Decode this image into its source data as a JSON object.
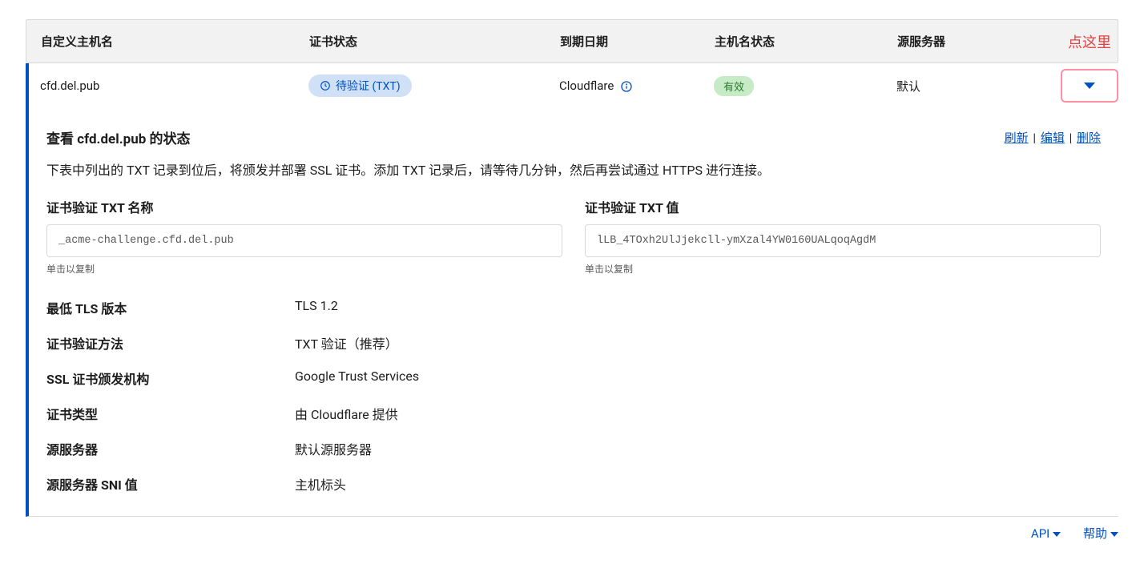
{
  "header": {
    "hostname": "自定义主机名",
    "cert_status": "证书状态",
    "expiry": "到期日期",
    "host_status": "主机名状态",
    "origin": "源服务器",
    "hint": "点这里"
  },
  "row": {
    "hostname": "cfd.del.pub",
    "cert_status_badge": "待验证 (TXT)",
    "expiry": "Cloudflare",
    "host_status_badge": "有效",
    "origin": "默认"
  },
  "detail": {
    "title": "查看 cfd.del.pub 的状态",
    "actions": {
      "refresh": "刷新",
      "edit": "编辑",
      "delete": "删除"
    },
    "desc": "下表中列出的 TXT 记录到位后，将颁发并部署 SSL 证书。添加 TXT 记录后，请等待几分钟，然后再尝试通过 HTTPS 进行连接。",
    "txt_name_label": "证书验证 TXT 名称",
    "txt_name_value": "_acme-challenge.cfd.del.pub",
    "txt_value_label": "证书验证 TXT 值",
    "txt_value_value": "lLB_4TOxh2UlJjekcll-ymXzal4YW0160UALqoqAgdM",
    "copy_hint": "单击以复制",
    "props": {
      "min_tls_label": "最低 TLS 版本",
      "min_tls_value": "TLS 1.2",
      "cert_method_label": "证书验证方法",
      "cert_method_value": "TXT 验证（推荐）",
      "ssl_ca_label": "SSL 证书颁发机构",
      "ssl_ca_value": "Google Trust Services",
      "cert_type_label": "证书类型",
      "cert_type_value": "由 Cloudflare 提供",
      "origin_label": "源服务器",
      "origin_value": "默认源服务器",
      "origin_sni_label": "源服务器 SNI 值",
      "origin_sni_value": "主机标头"
    }
  },
  "footer": {
    "api": "API",
    "help": "帮助"
  }
}
